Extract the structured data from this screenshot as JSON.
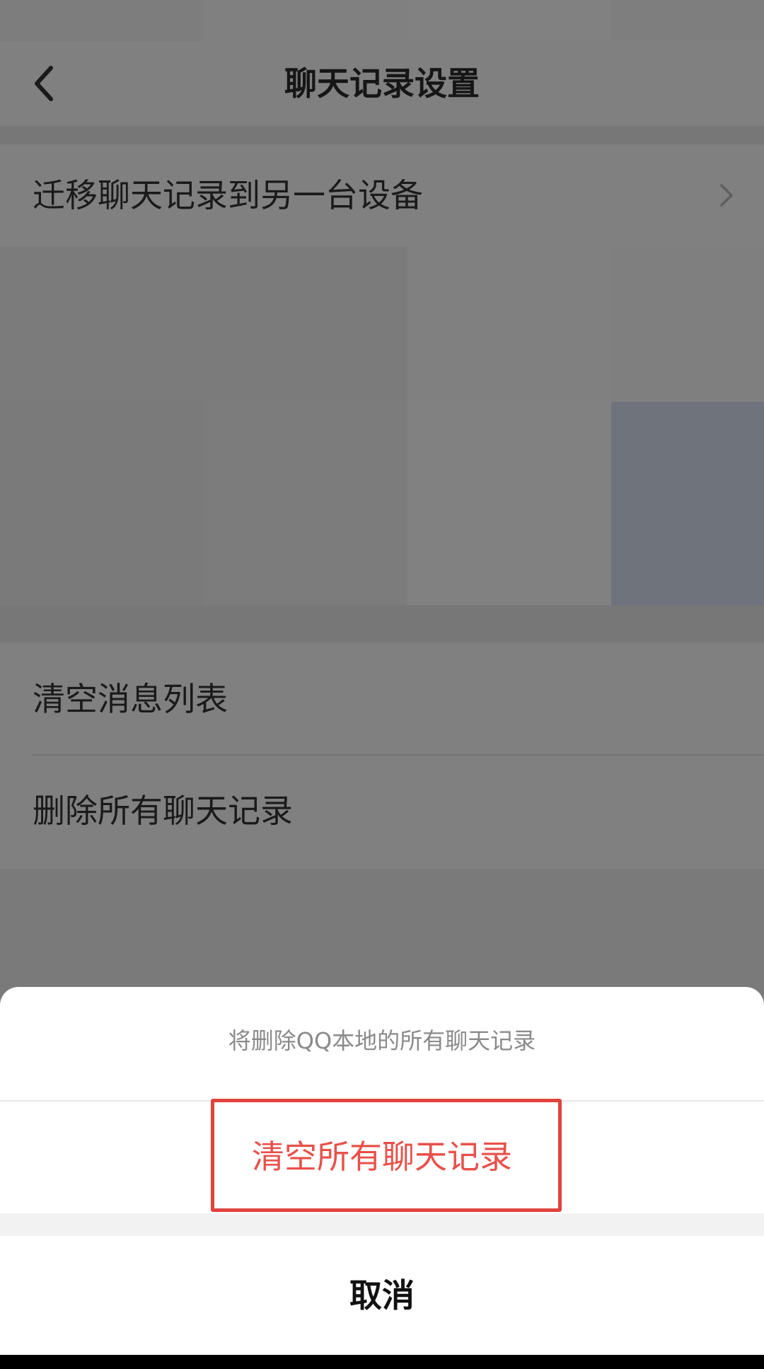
{
  "header": {
    "title": "聊天记录设置",
    "back_icon": "back-arrow-icon"
  },
  "rows": {
    "migrate": "迁移聊天记录到另一台设备",
    "clear_list": "清空消息列表",
    "delete_all": "删除所有聊天记录",
    "chevron_icon": "chevron-right-icon"
  },
  "sheet": {
    "message": "将删除QQ本地的所有聊天记录",
    "confirm": "清空所有聊天记录",
    "cancel": "取消"
  },
  "colors": {
    "overlay": "#7a7a7a",
    "danger": "#e8504a",
    "highlight_border": "#e0423c",
    "sheet_bg": "#ffffff"
  }
}
